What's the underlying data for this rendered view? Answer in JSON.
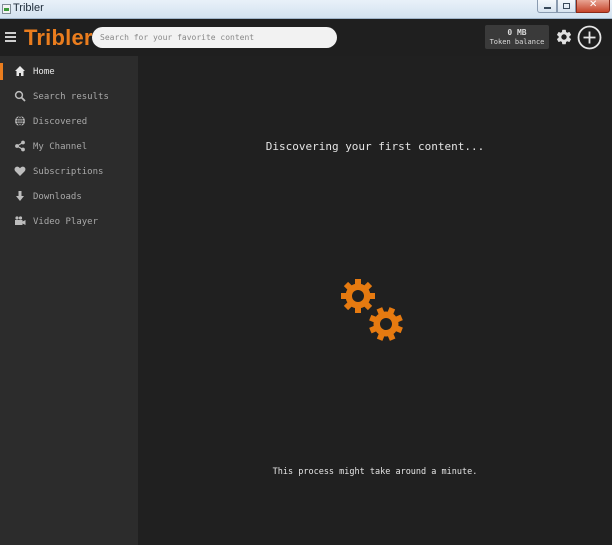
{
  "window": {
    "title": "Tribler"
  },
  "header": {
    "brand": "Tribler",
    "search_placeholder": "Search for your favorite content",
    "token_amount": "0 MB",
    "token_label": "Token balance",
    "settings_icon": "gear-icon",
    "add_icon": "plus-circle-icon",
    "accent_color": "#ea7d1e"
  },
  "sidebar": {
    "items": [
      {
        "label": "Home",
        "icon": "home-icon",
        "active": true
      },
      {
        "label": "Search results",
        "icon": "search-icon",
        "active": false
      },
      {
        "label": "Discovered",
        "icon": "globe-icon",
        "active": false
      },
      {
        "label": "My Channel",
        "icon": "share-icon",
        "active": false
      },
      {
        "label": "Subscriptions",
        "icon": "heart-icon",
        "active": false
      },
      {
        "label": "Downloads",
        "icon": "download-arrow-icon",
        "active": false
      },
      {
        "label": "Video Player",
        "icon": "video-camera-icon",
        "active": false
      }
    ]
  },
  "main": {
    "discovering_text": "Discovering your first content...",
    "loading_icon": "gears-icon",
    "wait_text": "This process might take around a minute."
  }
}
